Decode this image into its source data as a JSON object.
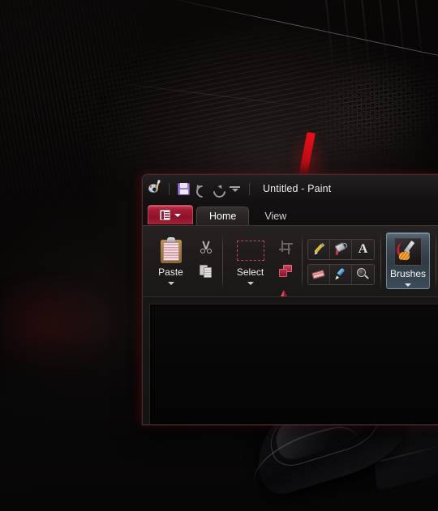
{
  "wallpaper": {
    "description": "dark automotive carbon-fibre wallpaper with red accent stripe",
    "accent_red": "#e8101a",
    "base_color": "#060404"
  },
  "desktop_object": {
    "name": "arc-mouse",
    "description": "glossy black arc mouse resting on dark desk surface"
  },
  "window": {
    "title": "Untitled - Paint",
    "app_icon": "paint-palette-icon",
    "quick_access_toolbar": [
      {
        "name": "save",
        "icon": "floppy-disk-icon",
        "label": "Save"
      },
      {
        "name": "undo",
        "icon": "undo-arrow-icon",
        "label": "Undo"
      },
      {
        "name": "redo",
        "icon": "redo-arrow-icon",
        "label": "Redo"
      },
      {
        "name": "customize",
        "icon": "chevron-down-bar-icon",
        "label": "Customize Quick Access Toolbar"
      }
    ],
    "file_menu": {
      "label": "File",
      "icon": "file-menu-icon",
      "caret": "chevron-down-icon",
      "color": "#a51d34"
    },
    "tabs": [
      {
        "label": "Home",
        "active": true
      },
      {
        "label": "View",
        "active": false
      }
    ],
    "ribbon": {
      "groups": [
        {
          "name": "clipboard",
          "big_button": {
            "label": "Paste",
            "icon": "clipboard-icon",
            "has_caret": true
          },
          "small_buttons": [
            {
              "label": "Cut",
              "icon": "scissors-icon"
            },
            {
              "label": "Copy",
              "icon": "copy-pages-icon"
            }
          ]
        },
        {
          "name": "image",
          "big_button": {
            "label": "Select",
            "icon": "dashed-rectangle-icon",
            "has_caret": true
          },
          "small_buttons": [
            {
              "label": "Crop",
              "icon": "crop-icon",
              "disabled": true
            },
            {
              "label": "Resize",
              "icon": "resize-icon"
            },
            {
              "label": "Rotate",
              "icon": "rotate-icon",
              "has_caret": true
            }
          ]
        },
        {
          "name": "tools",
          "rows": [
            [
              {
                "label": "Pencil",
                "icon": "pencil-icon"
              },
              {
                "label": "Fill with color",
                "icon": "paint-bucket-icon"
              },
              {
                "label": "Text",
                "icon": "text-a-icon",
                "glyph": "A"
              }
            ],
            [
              {
                "label": "Eraser",
                "icon": "eraser-icon"
              },
              {
                "label": "Color picker",
                "icon": "eyedropper-icon"
              },
              {
                "label": "Magnifier",
                "icon": "magnifier-icon"
              }
            ]
          ]
        },
        {
          "name": "brushes",
          "big_button": {
            "label": "Brushes",
            "icon": "paintbrush-icon",
            "has_caret": true,
            "highlighted": true,
            "highlight_color": "#41505c"
          }
        },
        {
          "name": "shapes",
          "clipped": true
        }
      ]
    },
    "canvas": {
      "name": "drawing-canvas",
      "fill": "#070606"
    }
  }
}
